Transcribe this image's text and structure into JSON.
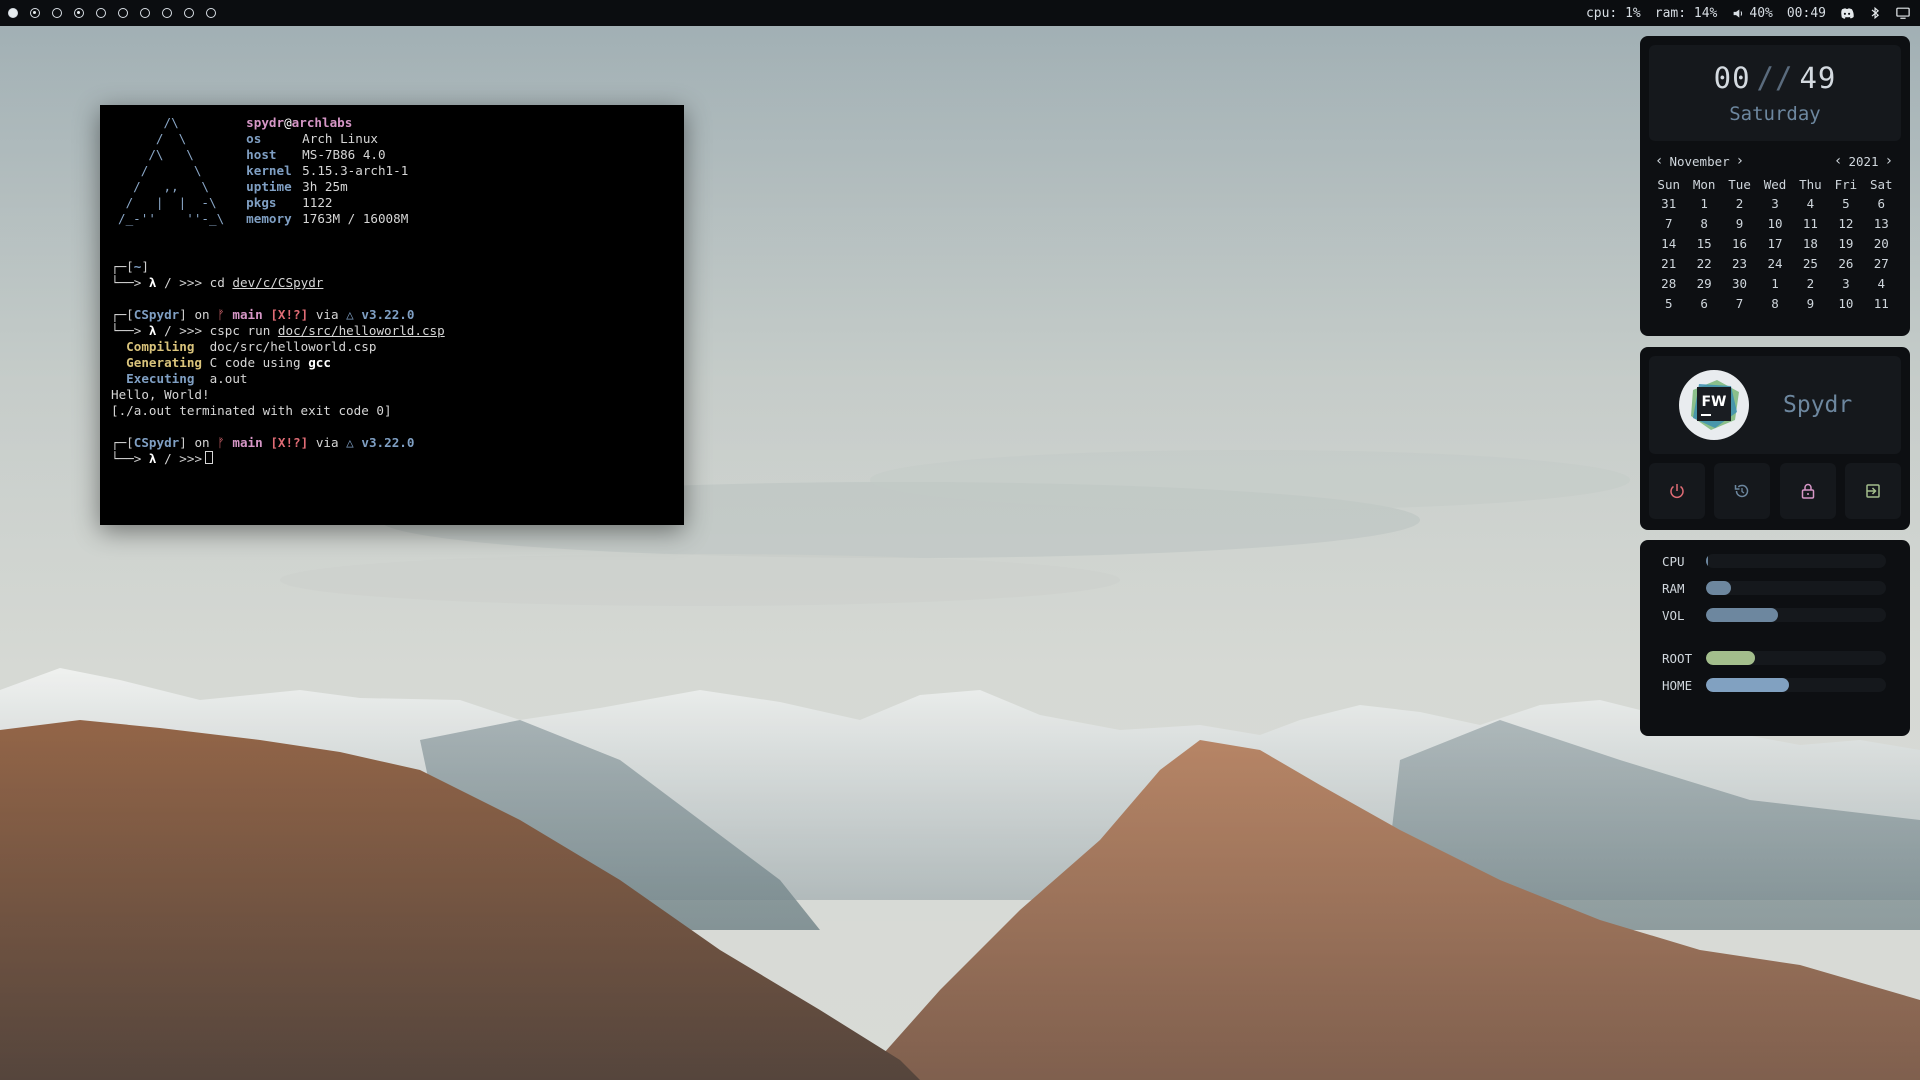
{
  "topbar": {
    "workspaces": [
      {
        "state": "active"
      },
      {
        "state": "occupied"
      },
      {
        "state": "empty"
      },
      {
        "state": "occupied"
      },
      {
        "state": "empty"
      },
      {
        "state": "empty"
      },
      {
        "state": "empty"
      },
      {
        "state": "empty"
      },
      {
        "state": "empty"
      },
      {
        "state": "empty"
      }
    ],
    "cpu": "cpu: 1%",
    "ram": "ram: 14%",
    "volume": "40%",
    "time": "00:49",
    "tray_icons": [
      "discord-icon",
      "bluetooth-icon",
      "monitor-icon"
    ]
  },
  "terminal": {
    "fetch": {
      "ascii": "      /\\\n     /  \\\n    /\\   \\\n   /      \\\n  /   ,,   \\\n /   |  |  -\\\n/_-''    ''-_\\",
      "user": "spydr",
      "at": "@",
      "host": "archlabs",
      "lines": [
        {
          "key": "os",
          "value": "Arch Linux"
        },
        {
          "key": "host",
          "value": "MS-7B86 4.0"
        },
        {
          "key": "kernel",
          "value": "5.15.3-arch1-1"
        },
        {
          "key": "uptime",
          "value": "3h 25m"
        },
        {
          "key": "pkgs",
          "value": "1122"
        },
        {
          "key": "memory",
          "value": "1763M / 16008M"
        }
      ]
    },
    "prompt1": {
      "dir": "~",
      "command": "cd",
      "arg": "dev/c/CSpydr"
    },
    "prompt2": {
      "dir": "CSpydr",
      "on": "on",
      "branch": "main",
      "status": "[X!?]",
      "via": "via",
      "version": "v3.22.0",
      "command": "cspc run",
      "arg": "doc/src/helloworld.csp"
    },
    "output": {
      "compiling_label": "Compiling",
      "compiling_value": "doc/src/helloworld.csp",
      "generating_label": "Generating",
      "generating_value": "C code using",
      "generating_tool": "gcc",
      "executing_label": "Executing",
      "executing_value": "a.out",
      "hello": "Hello, World!",
      "exit": "[./a.out terminated with exit code 0]"
    },
    "prompt3": {
      "dir": "CSpydr",
      "on": "on",
      "branch": "main",
      "status": "[X!?]",
      "via": "via",
      "version": "v3.22.0"
    },
    "lambda": "λ",
    "slash": "/",
    "arrows": ">>>"
  },
  "clock": {
    "hours": "00",
    "separator": "//",
    "minutes": "49",
    "day": "Saturday"
  },
  "calendar": {
    "month": "November",
    "year": "2021",
    "weekdays": [
      "Sun",
      "Mon",
      "Tue",
      "Wed",
      "Thu",
      "Fri",
      "Sat"
    ],
    "days": [
      "31",
      "1",
      "2",
      "3",
      "4",
      "5",
      "6",
      "7",
      "8",
      "9",
      "10",
      "11",
      "12",
      "13",
      "14",
      "15",
      "16",
      "17",
      "18",
      "19",
      "20",
      "21",
      "22",
      "23",
      "24",
      "25",
      "26",
      "27",
      "28",
      "29",
      "30",
      "1",
      "2",
      "3",
      "4",
      "5",
      "6",
      "7",
      "8",
      "9",
      "10",
      "11"
    ]
  },
  "profile": {
    "avatar_text": "FW",
    "name": "Spydr",
    "buttons": [
      "power-icon",
      "restart-icon",
      "lock-icon",
      "logout-icon"
    ]
  },
  "stats": [
    {
      "label": "CPU",
      "value": 0.01,
      "color": "#6d879f"
    },
    {
      "label": "RAM",
      "value": 0.14,
      "color": "#6d879f"
    },
    {
      "label": "VOL",
      "value": 0.4,
      "color": "#6d879f"
    },
    {
      "label": "ROOT",
      "value": 0.27,
      "color": "#a3be8c"
    },
    {
      "label": "HOME",
      "value": 0.46,
      "color": "#81a1c1"
    }
  ],
  "colors": {
    "accent": "#6d879f",
    "root_bar": "#a3be8c",
    "home_bar": "#81a1c1",
    "power": "#e06c75",
    "logout": "#a3be8c"
  }
}
